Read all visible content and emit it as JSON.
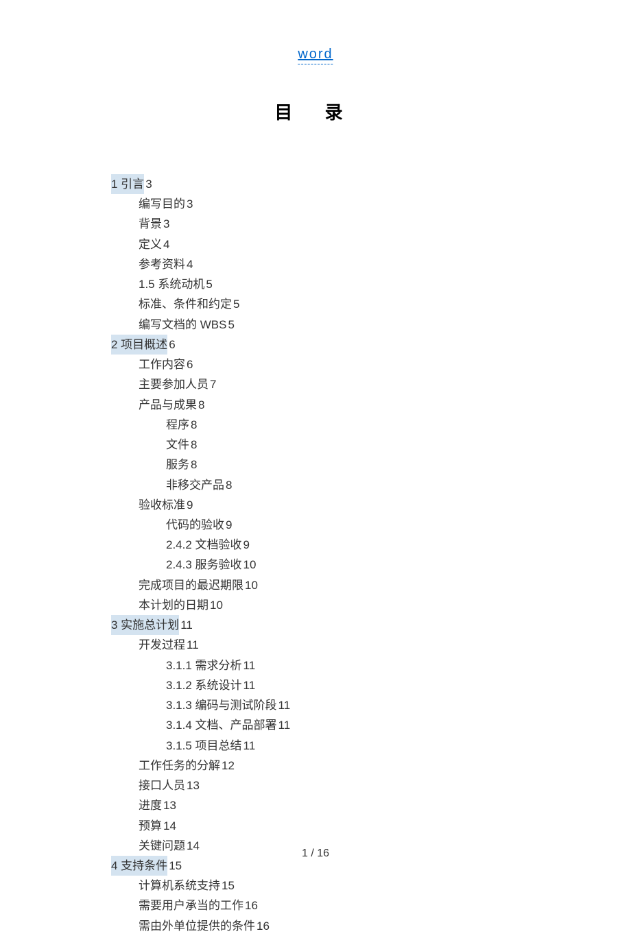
{
  "header": {
    "link_text": "word"
  },
  "title": "目  录",
  "toc": [
    {
      "level": 1,
      "chapter": "1 引言",
      "page": "3",
      "highlighted": true
    },
    {
      "level": 2,
      "chapter": "编写目的",
      "page": "3",
      "highlighted": false
    },
    {
      "level": 2,
      "chapter": "背景",
      "page": "3",
      "highlighted": false
    },
    {
      "level": 2,
      "chapter": "定义",
      "page": "4",
      "highlighted": false
    },
    {
      "level": 2,
      "chapter": "参考资料",
      "page": "4",
      "highlighted": false
    },
    {
      "level": 2,
      "chapter": "1.5  系统动机",
      "page": "5",
      "highlighted": false
    },
    {
      "level": 2,
      "chapter": "标准、条件和约定",
      "page": "5",
      "highlighted": false
    },
    {
      "level": 2,
      "chapter": "编写文档的 WBS",
      "page": "5",
      "highlighted": false
    },
    {
      "level": 1,
      "chapter": "2 项目概述",
      "page": "6",
      "highlighted": true
    },
    {
      "level": 2,
      "chapter": "工作内容",
      "page": "6",
      "highlighted": false
    },
    {
      "level": 2,
      "chapter": "主要参加人员",
      "page": "7",
      "highlighted": false
    },
    {
      "level": 2,
      "chapter": "产品与成果",
      "page": "8",
      "highlighted": false
    },
    {
      "level": 3,
      "chapter": "程序",
      "page": "8",
      "highlighted": false
    },
    {
      "level": 3,
      "chapter": "文件",
      "page": "8",
      "highlighted": false
    },
    {
      "level": 3,
      "chapter": "服务",
      "page": "8",
      "highlighted": false
    },
    {
      "level": 3,
      "chapter": "非移交产品",
      "page": "8",
      "highlighted": false
    },
    {
      "level": 2,
      "chapter": "验收标准",
      "page": "9",
      "highlighted": false
    },
    {
      "level": 3,
      "chapter": "代码的验收",
      "page": "9",
      "highlighted": false
    },
    {
      "level": 3,
      "chapter": "2.4.2  文档验收",
      "page": "9",
      "highlighted": false
    },
    {
      "level": 3,
      "chapter": "2.4.3  服务验收",
      "page": "10",
      "highlighted": false
    },
    {
      "level": 2,
      "chapter": "完成项目的最迟期限",
      "page": "10",
      "highlighted": false
    },
    {
      "level": 2,
      "chapter": "本计划的日期",
      "page": "10",
      "highlighted": false
    },
    {
      "level": 1,
      "chapter": "3 实施总计划",
      "page": "11",
      "highlighted": true
    },
    {
      "level": 2,
      "chapter": "开发过程",
      "page": "11",
      "highlighted": false
    },
    {
      "level": 3,
      "chapter": "3.1.1  需求分析",
      "page": "11",
      "highlighted": false
    },
    {
      "level": 3,
      "chapter": "3.1.2  系统设计",
      "page": "11",
      "highlighted": false
    },
    {
      "level": 3,
      "chapter": "3.1.3  编码与测试阶段",
      "page": "11",
      "highlighted": false
    },
    {
      "level": 3,
      "chapter": "3.1.4  文档、产品部署",
      "page": "11",
      "highlighted": false
    },
    {
      "level": 3,
      "chapter": "3.1.5  项目总结",
      "page": "11",
      "highlighted": false
    },
    {
      "level": 2,
      "chapter": "工作任务的分解",
      "page": "12",
      "highlighted": false
    },
    {
      "level": 2,
      "chapter": "接口人员",
      "page": "13",
      "highlighted": false
    },
    {
      "level": 2,
      "chapter": "进度",
      "page": "13",
      "highlighted": false
    },
    {
      "level": 2,
      "chapter": "预算",
      "page": "14",
      "highlighted": false
    },
    {
      "level": 2,
      "chapter": "关键问题",
      "page": "14",
      "highlighted": false
    },
    {
      "level": 1,
      "chapter": "4 支持条件",
      "page": "15",
      "highlighted": true
    },
    {
      "level": 2,
      "chapter": "计算机系统支持",
      "page": "15",
      "highlighted": false
    },
    {
      "level": 2,
      "chapter": "需要用户承当的工作",
      "page": "16",
      "highlighted": false
    },
    {
      "level": 2,
      "chapter": "需由外单位提供的条件",
      "page": "16",
      "highlighted": false
    }
  ],
  "footer": {
    "page_indicator": "1 / 16"
  }
}
